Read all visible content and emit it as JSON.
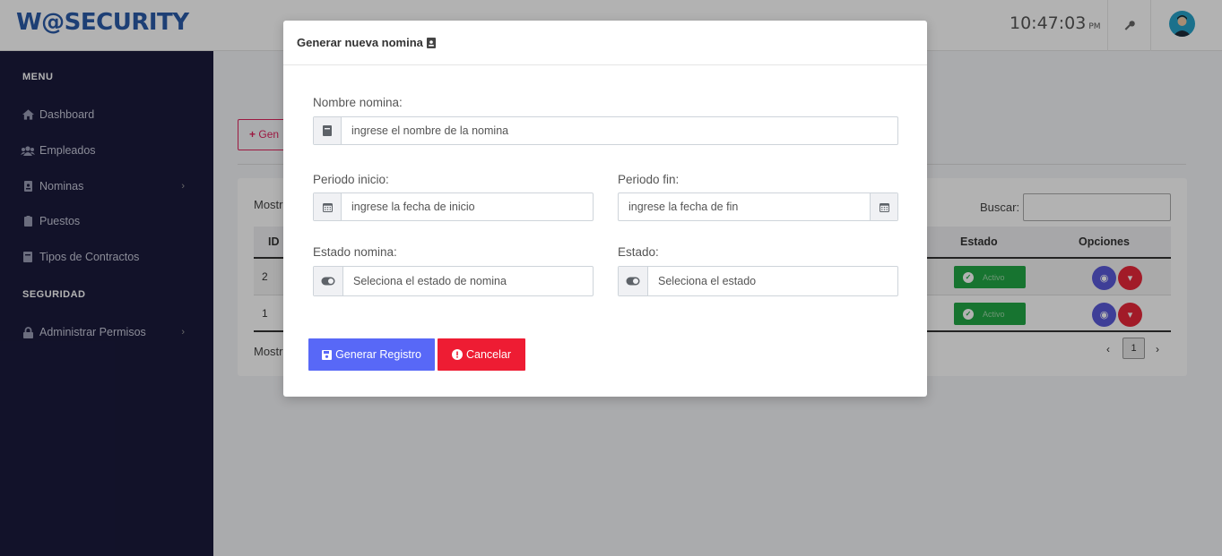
{
  "header": {
    "logo": "W@SECURITY",
    "time": "10:47:03",
    "ampm": "PM"
  },
  "sidebar": {
    "sections": [
      {
        "title": "MENU"
      },
      {
        "title": "SEGURIDAD"
      }
    ],
    "items": [
      {
        "label": "Dashboard",
        "icon": "home-icon"
      },
      {
        "label": "Empleados",
        "icon": "users-icon"
      },
      {
        "label": "Nominas",
        "icon": "id-badge-icon",
        "has_submenu": true
      },
      {
        "label": "Puestos",
        "icon": "clipboard-icon"
      },
      {
        "label": "Tipos de Contractos",
        "icon": "book-icon"
      },
      {
        "label": "Administrar Permisos",
        "icon": "lock-icon",
        "has_submenu": true
      }
    ]
  },
  "main": {
    "new_button": "Gen",
    "show_label": "Mostr",
    "show_label_bottom": "Mostr",
    "search_label": "Buscar:",
    "columns": [
      "ID",
      "Estado",
      "Opciones"
    ],
    "rows": [
      {
        "id": "2",
        "status": "Activo"
      },
      {
        "id": "1",
        "status": "Activo"
      }
    ],
    "pagination": {
      "prev": "‹",
      "page": "1",
      "next": "›"
    }
  },
  "modal": {
    "title": "Generar nueva nomina",
    "fields": {
      "nombre": {
        "label": "Nombre nomina:",
        "placeholder": "ingrese el nombre de la nomina"
      },
      "inicio": {
        "label": "Periodo inicio:",
        "placeholder": "ingrese la fecha de inicio"
      },
      "fin": {
        "label": "Periodo fin:",
        "placeholder": "ingrese la fecha de fin"
      },
      "estado_nomina": {
        "label": "Estado nomina:",
        "placeholder": "Seleciona el estado de nomina"
      },
      "estado": {
        "label": "Estado:",
        "placeholder": "Seleciona el estado"
      }
    },
    "buttons": {
      "submit": "Generar Registro",
      "cancel": "Cancelar"
    }
  },
  "colors": {
    "sidebar_bg": "#1a1a3c",
    "logo": "#2a5ba8",
    "primary": "#5868f7",
    "danger": "#ee1c33",
    "success": "#22a745"
  }
}
